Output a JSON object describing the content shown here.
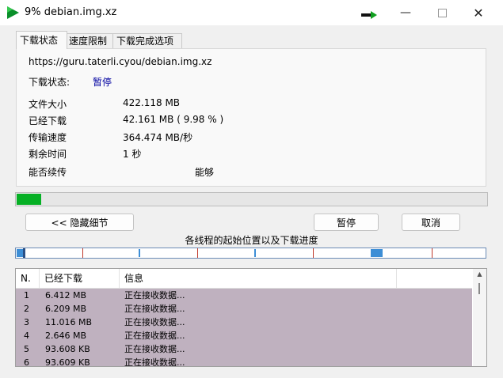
{
  "window": {
    "title": "9% debian.img.xz"
  },
  "tabs": [
    {
      "label": "下载状态"
    },
    {
      "label": "速度限制"
    },
    {
      "label": "下载完成选项"
    }
  ],
  "status": {
    "url": "https://guru.taterli.cyou/debian.img.xz",
    "state_label": "下载状态:",
    "state_value": "暂停",
    "file_size_label": "文件大小",
    "file_size": "422.118  MB",
    "downloaded_label": "已经下载",
    "downloaded": "42.161  MB  ( 9.98 % )",
    "speed_label": "传输速度",
    "speed": "364.474  MB/秒",
    "remaining_label": "剩余时间",
    "remaining": "1 秒",
    "resume_label": "能否续传",
    "resume": "能够"
  },
  "progress": {
    "percent": 9.98
  },
  "buttons": {
    "hide_details": "<< 隐藏细节",
    "pause": "暂停",
    "cancel": "取消"
  },
  "threads": {
    "title": "各线程的起始位置以及下载进度"
  },
  "table": {
    "headers": [
      "N.",
      "已经下载",
      "信息"
    ],
    "rows": [
      {
        "n": "1",
        "downloaded": "6.412  MB",
        "info": "正在接收数据..."
      },
      {
        "n": "2",
        "downloaded": "6.209  MB",
        "info": "正在接收数据..."
      },
      {
        "n": "3",
        "downloaded": "11.016  MB",
        "info": "正在接收数据..."
      },
      {
        "n": "4",
        "downloaded": "2.646  MB",
        "info": "正在接收数据..."
      },
      {
        "n": "5",
        "downloaded": "93.608  KB",
        "info": "正在接收数据..."
      },
      {
        "n": "6",
        "downloaded": "93.609  KB",
        "info": "正在接收数据..."
      }
    ]
  },
  "colors": {
    "progress_fill": "#06b025",
    "state_value": "#0000a0",
    "row_background": "#bfb1bf",
    "thread_marker": "#3d8ed6",
    "thread_divider": "#c0392b"
  },
  "icons": {
    "app": "green-play-icon",
    "tray": "green-arrow-icon"
  }
}
